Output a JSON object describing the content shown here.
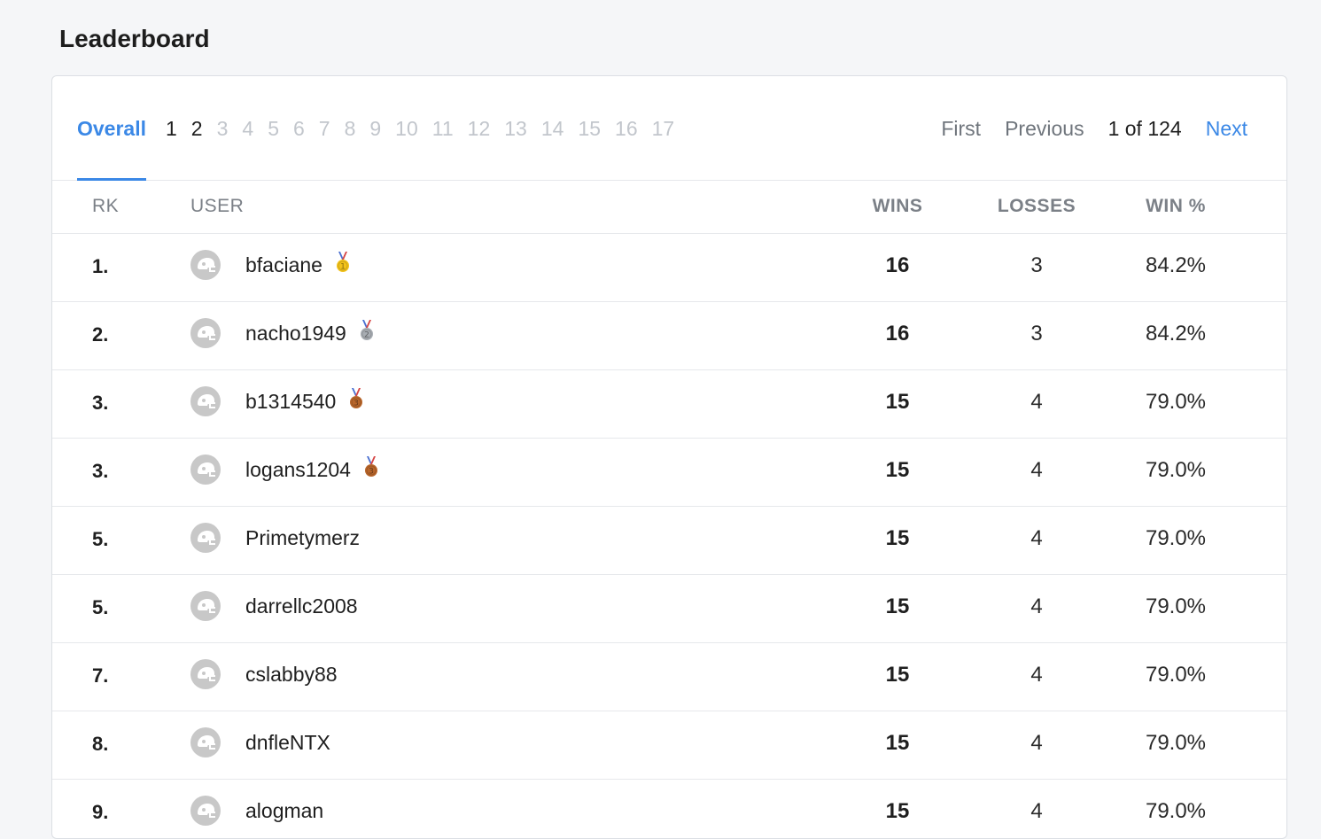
{
  "page": {
    "title": "Leaderboard"
  },
  "tabs": [
    {
      "label": "Overall",
      "state": "active"
    },
    {
      "label": "1",
      "state": "enabled"
    },
    {
      "label": "2",
      "state": "enabled"
    },
    {
      "label": "3",
      "state": "disabled"
    },
    {
      "label": "4",
      "state": "disabled"
    },
    {
      "label": "5",
      "state": "disabled"
    },
    {
      "label": "6",
      "state": "disabled"
    },
    {
      "label": "7",
      "state": "disabled"
    },
    {
      "label": "8",
      "state": "disabled"
    },
    {
      "label": "9",
      "state": "disabled"
    },
    {
      "label": "10",
      "state": "disabled"
    },
    {
      "label": "11",
      "state": "disabled"
    },
    {
      "label": "12",
      "state": "disabled"
    },
    {
      "label": "13",
      "state": "disabled"
    },
    {
      "label": "14",
      "state": "disabled"
    },
    {
      "label": "15",
      "state": "disabled"
    },
    {
      "label": "16",
      "state": "disabled"
    },
    {
      "label": "17",
      "state": "disabled"
    }
  ],
  "pager": {
    "first": "First",
    "previous": "Previous",
    "status": "1 of 124",
    "next": "Next"
  },
  "table": {
    "columns": {
      "rank": "RK",
      "user": "USER",
      "wins": "WINS",
      "losses": "LOSSES",
      "win_pct": "WIN %"
    },
    "rows": [
      {
        "rank": "1.",
        "user": "bfaciane",
        "medal": "gold-medal-icon",
        "wins": "16",
        "losses": "3",
        "win_pct": "84.2%"
      },
      {
        "rank": "2.",
        "user": "nacho1949",
        "medal": "silver-medal-icon",
        "wins": "16",
        "losses": "3",
        "win_pct": "84.2%"
      },
      {
        "rank": "3.",
        "user": "b1314540",
        "medal": "bronze-medal-icon",
        "wins": "15",
        "losses": "4",
        "win_pct": "79.0%"
      },
      {
        "rank": "3.",
        "user": "logans1204",
        "medal": "bronze-medal-icon",
        "wins": "15",
        "losses": "4",
        "win_pct": "79.0%"
      },
      {
        "rank": "5.",
        "user": "Primetymerz",
        "medal": "",
        "wins": "15",
        "losses": "4",
        "win_pct": "79.0%"
      },
      {
        "rank": "5.",
        "user": "darrellc2008",
        "medal": "",
        "wins": "15",
        "losses": "4",
        "win_pct": "79.0%"
      },
      {
        "rank": "7.",
        "user": "cslabby88",
        "medal": "",
        "wins": "15",
        "losses": "4",
        "win_pct": "79.0%"
      },
      {
        "rank": "8.",
        "user": "dnfleNTX",
        "medal": "",
        "wins": "15",
        "losses": "4",
        "win_pct": "79.0%"
      },
      {
        "rank": "9.",
        "user": "alogman",
        "medal": "",
        "wins": "15",
        "losses": "4",
        "win_pct": "79.0%"
      }
    ]
  },
  "colors": {
    "accent": "#3b88e6",
    "gold": "#f2c21b",
    "silver": "#a8adb3",
    "bronze": "#b8652a"
  }
}
